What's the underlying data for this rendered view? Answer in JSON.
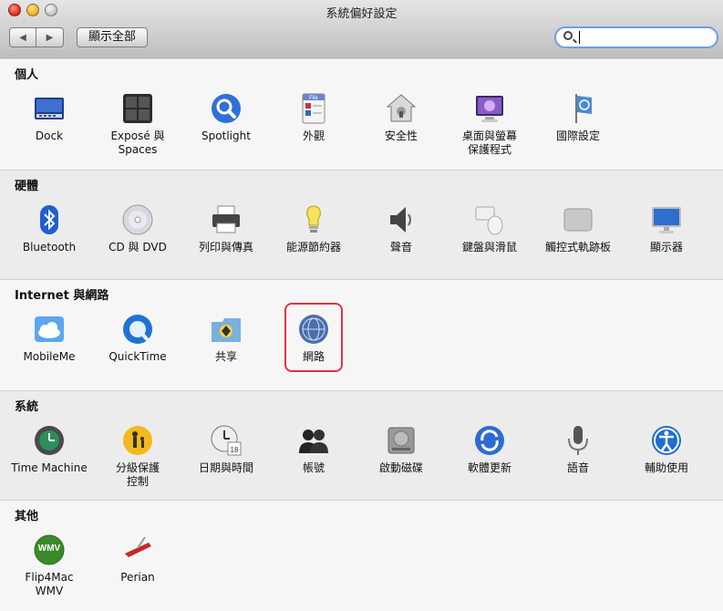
{
  "window": {
    "title": "系統偏好設定",
    "show_all_label": "顯示全部",
    "search": {
      "value": "",
      "placeholder": ""
    },
    "back_glyph": "◀",
    "forward_glyph": "▶"
  },
  "sections": [
    {
      "title": "個人",
      "items": [
        {
          "label": "Dock",
          "icon": "dock-icon"
        },
        {
          "label": "Exposé 與\nSpaces",
          "icon": "expose-icon"
        },
        {
          "label": "Spotlight",
          "icon": "spotlight-icon"
        },
        {
          "label": "外觀",
          "icon": "appearance-icon"
        },
        {
          "label": "安全性",
          "icon": "security-icon"
        },
        {
          "label": "桌面與螢幕\n保護程式",
          "icon": "desktop-icon"
        },
        {
          "label": "國際設定",
          "icon": "international-icon"
        }
      ]
    },
    {
      "title": "硬體",
      "items": [
        {
          "label": "Bluetooth",
          "icon": "bluetooth-icon"
        },
        {
          "label": "CD 與 DVD",
          "icon": "cd-dvd-icon"
        },
        {
          "label": "列印與傳真",
          "icon": "printer-icon"
        },
        {
          "label": "能源節約器",
          "icon": "energy-saver-icon"
        },
        {
          "label": "聲音",
          "icon": "sound-icon"
        },
        {
          "label": "鍵盤與滑鼠",
          "icon": "keyboard-mouse-icon"
        },
        {
          "label": "觸控式軌跡板",
          "icon": "trackpad-icon"
        },
        {
          "label": "顯示器",
          "icon": "display-icon"
        }
      ]
    },
    {
      "title": "Internet 與網路",
      "items": [
        {
          "label": "MobileMe",
          "icon": "mobileme-icon"
        },
        {
          "label": "QuickTime",
          "icon": "quicktime-icon"
        },
        {
          "label": "共享",
          "icon": "sharing-icon"
        },
        {
          "label": "網路",
          "icon": "network-icon",
          "highlighted": true
        }
      ]
    },
    {
      "title": "系統",
      "items": [
        {
          "label": "Time Machine",
          "icon": "time-machine-icon"
        },
        {
          "label": "分級保護\n控制",
          "icon": "parental-controls-icon"
        },
        {
          "label": "日期與時間",
          "icon": "date-time-icon"
        },
        {
          "label": "帳號",
          "icon": "accounts-icon"
        },
        {
          "label": "啟動磁碟",
          "icon": "startup-disk-icon"
        },
        {
          "label": "軟體更新",
          "icon": "software-update-icon"
        },
        {
          "label": "語音",
          "icon": "speech-icon"
        },
        {
          "label": "輔助使用",
          "icon": "universal-access-icon"
        }
      ]
    },
    {
      "title": "其他",
      "items": [
        {
          "label": "Flip4Mac\nWMV",
          "icon": "flip4mac-icon",
          "badge": "WMV"
        },
        {
          "label": "Perian",
          "icon": "perian-icon"
        }
      ]
    }
  ],
  "colors": {
    "highlight": "#e0334c",
    "search_focus": "#6d9fe0"
  }
}
